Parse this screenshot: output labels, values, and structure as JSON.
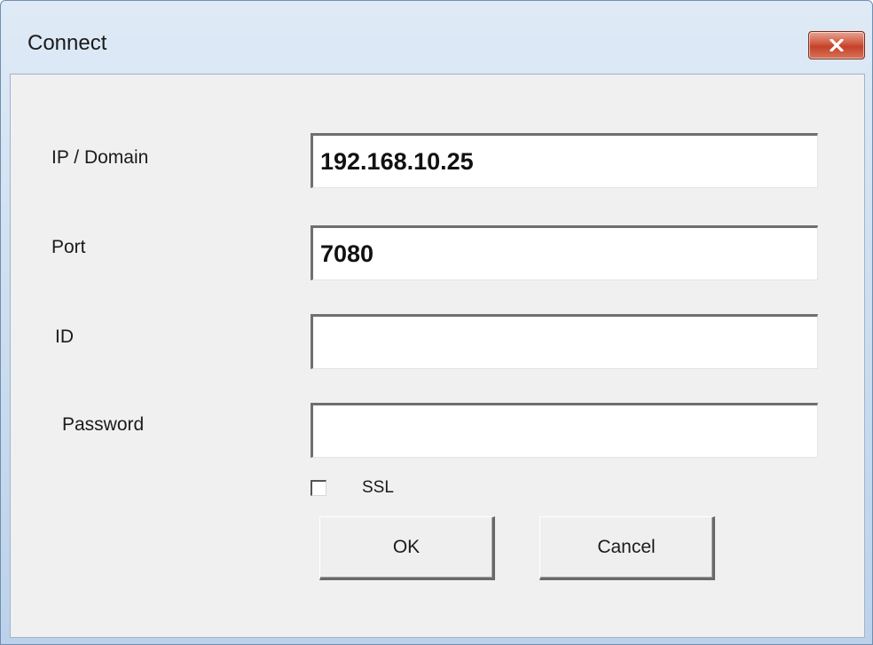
{
  "window": {
    "title": "Connect",
    "close_icon": "close-x-icon"
  },
  "form": {
    "ip_domain": {
      "label": "IP / Domain",
      "value": "192.168.10.25"
    },
    "port": {
      "label": "Port",
      "value": "7080"
    },
    "id": {
      "label": "ID",
      "value": ""
    },
    "password": {
      "label": "Password",
      "value": ""
    },
    "ssl": {
      "label": "SSL",
      "checked": false
    }
  },
  "buttons": {
    "ok_label": "OK",
    "cancel_label": "Cancel"
  },
  "colors": {
    "titlebar": "#c9dbee",
    "close_button": "#c4412a",
    "dialog_background": "#f0f0f0"
  }
}
